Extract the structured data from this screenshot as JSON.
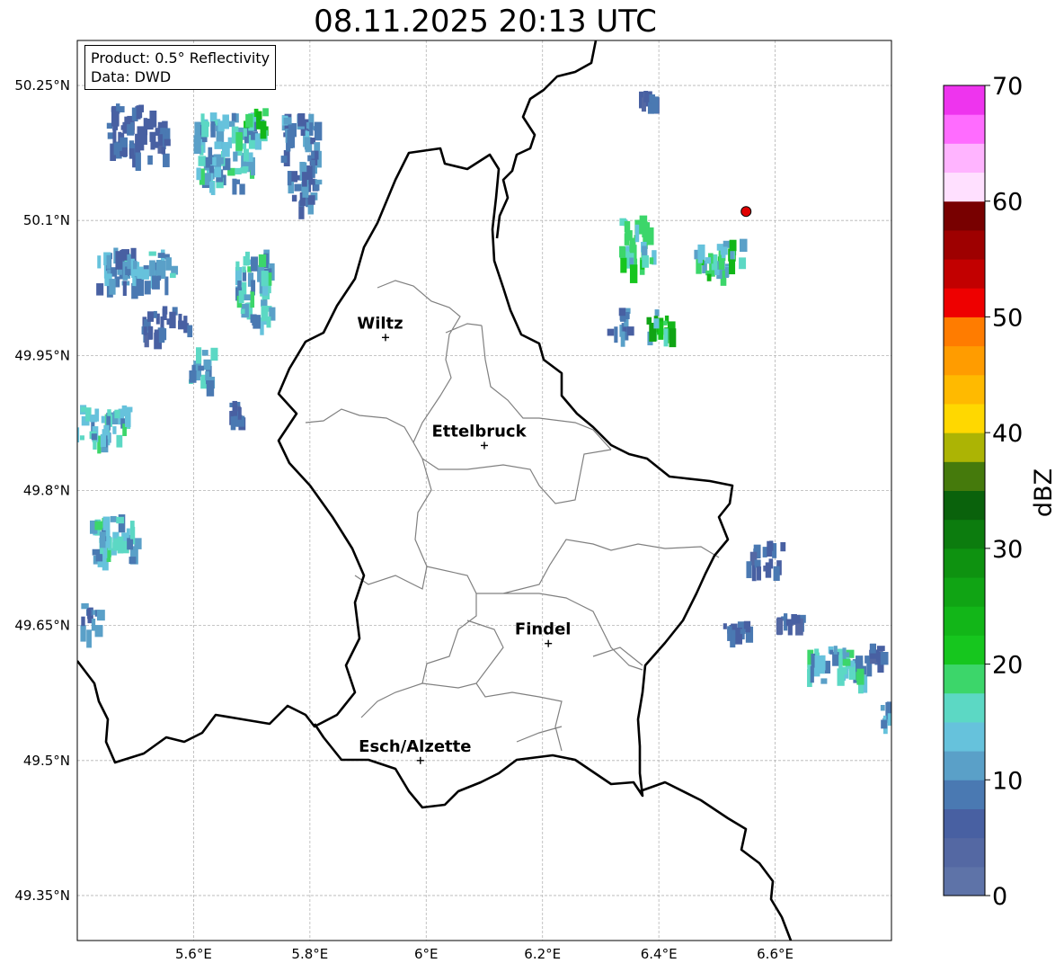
{
  "title": "08.11.2025 20:13 UTC",
  "info": {
    "product": "Product: 0.5° Reflectivity",
    "data": "Data: DWD"
  },
  "map": {
    "lon_range": [
      5.4,
      6.8
    ],
    "lat_range": [
      49.3,
      50.3
    ],
    "lat_ticks": [
      {
        "value": 50.25,
        "label": "50.25°N"
      },
      {
        "value": 50.1,
        "label": "50.1°N"
      },
      {
        "value": 49.95,
        "label": "49.95°N"
      },
      {
        "value": 49.8,
        "label": "49.8°N"
      },
      {
        "value": 49.65,
        "label": "49.65°N"
      },
      {
        "value": 49.5,
        "label": "49.5°N"
      },
      {
        "value": 49.35,
        "label": "49.35°N"
      }
    ],
    "lon_ticks": [
      {
        "value": 5.6,
        "label": "5.6°E"
      },
      {
        "value": 5.8,
        "label": "5.8°E"
      },
      {
        "value": 6.0,
        "label": "6°E"
      },
      {
        "value": 6.2,
        "label": "6.2°E"
      },
      {
        "value": 6.4,
        "label": "6.4°E"
      },
      {
        "value": 6.6,
        "label": "6.6°E"
      }
    ],
    "cities": [
      {
        "name": "Wiltz",
        "lon": 5.93,
        "lat": 49.97
      },
      {
        "name": "Ettelbruck",
        "lon": 6.1,
        "lat": 49.85
      },
      {
        "name": "Findel",
        "lon": 6.21,
        "lat": 49.63
      },
      {
        "name": "Esch/Alzette",
        "lon": 5.99,
        "lat": 49.5
      }
    ],
    "marker": {
      "lon": 6.55,
      "lat": 50.11,
      "color": "#e00000"
    }
  },
  "colorbar": {
    "label": "dBZ",
    "ticks": [
      "0",
      "10",
      "20",
      "30",
      "40",
      "50",
      "60",
      "70"
    ],
    "min": 0,
    "max": 70,
    "step": 2.5,
    "colors": [
      "#5e73a8",
      "#5468a3",
      "#4860a2",
      "#4a79b2",
      "#5aa0c8",
      "#66c2dc",
      "#5cd8c4",
      "#3cd66a",
      "#16c61e",
      "#12b618",
      "#10a414",
      "#0e9210",
      "#0c7c0e",
      "#0a620c",
      "#457a0c",
      "#acb404",
      "#ffd800",
      "#ffba00",
      "#ff9c00",
      "#ff7c00",
      "#ee0000",
      "#c20000",
      "#9e0000",
      "#780000",
      "#ffe0ff",
      "#ffb4ff",
      "#ff6cff",
      "#ee34ee"
    ]
  },
  "echoes": [
    {
      "lon": 5.5,
      "lat": 50.2,
      "w": 0.1,
      "h": 0.06,
      "level": 3
    },
    {
      "lon": 5.65,
      "lat": 50.18,
      "w": 0.1,
      "h": 0.08,
      "level": 6
    },
    {
      "lon": 5.7,
      "lat": 50.21,
      "w": 0.04,
      "h": 0.03,
      "level": 9
    },
    {
      "lon": 5.78,
      "lat": 50.17,
      "w": 0.06,
      "h": 0.1,
      "level": 4
    },
    {
      "lon": 5.5,
      "lat": 50.05,
      "w": 0.14,
      "h": 0.04,
      "level": 5
    },
    {
      "lon": 5.7,
      "lat": 50.03,
      "w": 0.06,
      "h": 0.08,
      "level": 6
    },
    {
      "lon": 5.55,
      "lat": 49.99,
      "w": 0.08,
      "h": 0.03,
      "level": 3
    },
    {
      "lon": 5.61,
      "lat": 49.94,
      "w": 0.04,
      "h": 0.04,
      "level": 5
    },
    {
      "lon": 5.44,
      "lat": 49.88,
      "w": 0.09,
      "h": 0.04,
      "level": 6
    },
    {
      "lon": 5.46,
      "lat": 49.75,
      "w": 0.08,
      "h": 0.05,
      "level": 6
    },
    {
      "lon": 5.42,
      "lat": 49.66,
      "w": 0.03,
      "h": 0.03,
      "level": 4
    },
    {
      "lon": 5.67,
      "lat": 49.89,
      "w": 0.02,
      "h": 0.02,
      "level": 3
    },
    {
      "lon": 6.36,
      "lat": 50.08,
      "w": 0.06,
      "h": 0.06,
      "level": 7
    },
    {
      "lon": 6.5,
      "lat": 50.06,
      "w": 0.08,
      "h": 0.04,
      "level": 8
    },
    {
      "lon": 6.4,
      "lat": 49.99,
      "w": 0.05,
      "h": 0.03,
      "level": 9
    },
    {
      "lon": 6.33,
      "lat": 49.99,
      "w": 0.04,
      "h": 0.03,
      "level": 4
    },
    {
      "lon": 6.38,
      "lat": 50.24,
      "w": 0.03,
      "h": 0.01,
      "level": 3
    },
    {
      "lon": 6.58,
      "lat": 49.73,
      "w": 0.06,
      "h": 0.03,
      "level": 3
    },
    {
      "lon": 6.62,
      "lat": 49.66,
      "w": 0.04,
      "h": 0.01,
      "level": 3
    },
    {
      "lon": 6.7,
      "lat": 49.61,
      "w": 0.1,
      "h": 0.04,
      "level": 6
    },
    {
      "lon": 6.77,
      "lat": 49.62,
      "w": 0.04,
      "h": 0.02,
      "level": 3
    },
    {
      "lon": 6.79,
      "lat": 49.56,
      "w": 0.03,
      "h": 0.03,
      "level": 5
    },
    {
      "lon": 6.53,
      "lat": 49.65,
      "w": 0.04,
      "h": 0.01,
      "level": 3
    }
  ]
}
